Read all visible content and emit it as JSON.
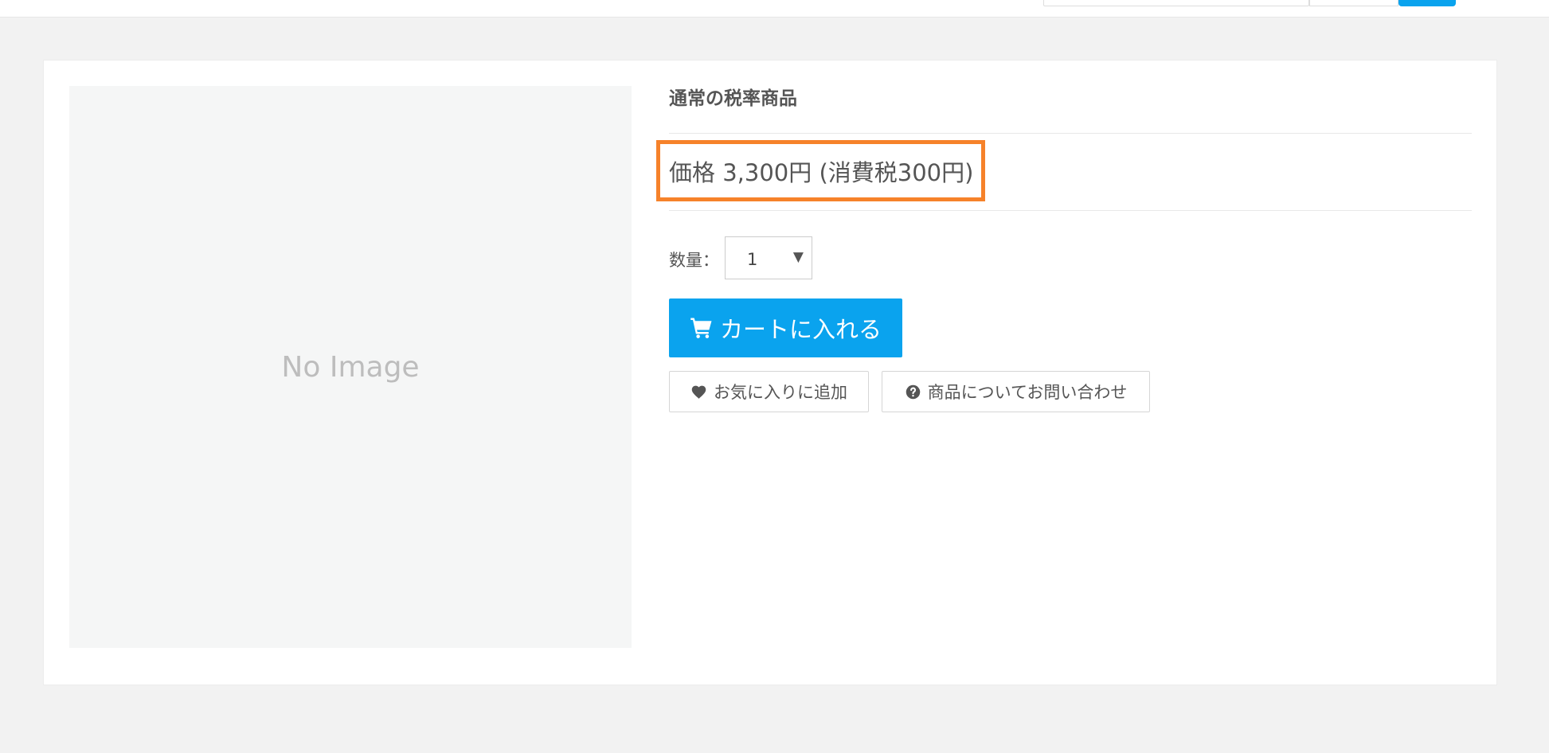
{
  "product": {
    "image_placeholder": "No Image",
    "title": "通常の税率商品",
    "price": "価格 3,300円 (消費税300円)",
    "quantity_label": "数量：",
    "quantity_value": "1",
    "add_to_cart_label": "カートに入れる",
    "favorite_label": "お気に入りに追加",
    "contact_label": "商品についてお問い合わせ"
  },
  "colors": {
    "primary": "#0aa3ee",
    "highlight": "#f6822a",
    "page_background": "#f2f2f2"
  }
}
